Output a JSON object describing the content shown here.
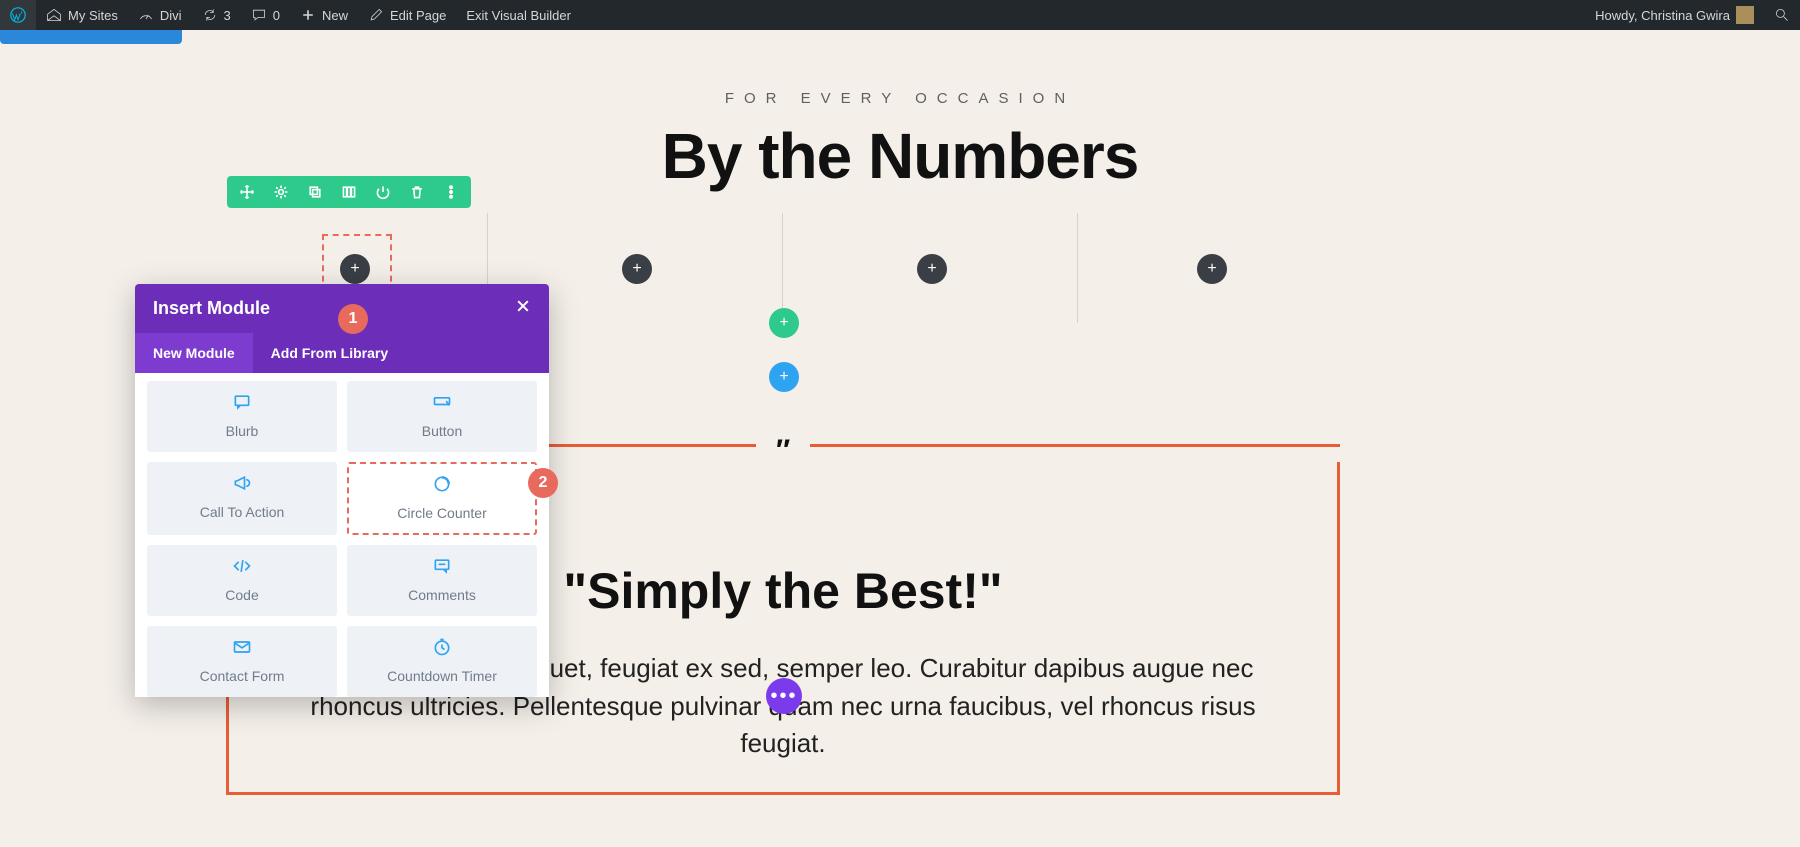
{
  "adminbar": {
    "my_sites": "My Sites",
    "divi": "Divi",
    "updates": "3",
    "comments": "0",
    "new": "New",
    "edit_page": "Edit Page",
    "exit_builder": "Exit Visual Builder",
    "howdy": "Howdy, Christina Gwira"
  },
  "section": {
    "overline": "FOR EVERY OCCASION",
    "title": "By the Numbers"
  },
  "row_toolbar": {
    "icons": [
      "move",
      "settings",
      "duplicate",
      "columns",
      "power",
      "delete",
      "more"
    ]
  },
  "modal": {
    "title": "Insert Module",
    "tabs": {
      "new": "New Module",
      "library": "Add From Library"
    },
    "modules": [
      {
        "label": "Blurb",
        "icon": "chat",
        "selected": false
      },
      {
        "label": "Button",
        "icon": "button",
        "selected": false
      },
      {
        "label": "Call To Action",
        "icon": "megaphone",
        "selected": false
      },
      {
        "label": "Circle Counter",
        "icon": "circle-counter",
        "selected": true
      },
      {
        "label": "Code",
        "icon": "code",
        "selected": false
      },
      {
        "label": "Comments",
        "icon": "comments",
        "selected": false
      },
      {
        "label": "Contact Form",
        "icon": "mail",
        "selected": false
      },
      {
        "label": "Countdown Timer",
        "icon": "clock",
        "selected": false
      }
    ]
  },
  "badges": {
    "one": "1",
    "two": "2"
  },
  "testimonial": {
    "quote_mark": "″",
    "heading": "\"Simply the Best!\"",
    "body": "Nunc nec neque aliquet, feugiat ex sed, semper leo. Curabitur dapibus augue nec rhoncus ultricies. Pellentesque pulvinar quam nec urna faucibus, vel rhoncus risus feugiat."
  },
  "plus": "+",
  "ellipsis": "•••"
}
